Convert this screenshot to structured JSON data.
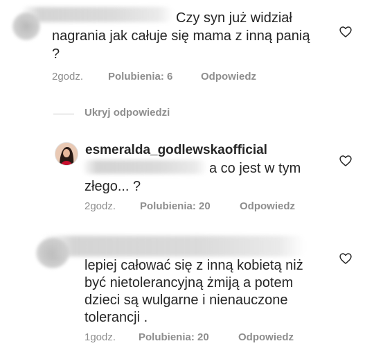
{
  "comments": [
    {
      "text_line1": "Czy syn już widział",
      "text_line2": "nagrania jak całuje się mama z inną panią",
      "text_line3": "?",
      "time": "2godz.",
      "likes": "Polubienia: 6",
      "reply": "Odpowiedz"
    },
    {
      "username": "esmeralda_godlewskaofficial",
      "text_line1": "a co jest w tym",
      "text_line2": "złego... ?",
      "time": "2godz.",
      "likes": "Polubienia: 20",
      "reply": "Odpowiedz"
    },
    {
      "text_line1": "lepiej całować się z inną kobietą niż",
      "text_line2": "być nietolerancyjną żmiją a potem",
      "text_line3": "dzieci są wulgarne i nienauczone",
      "text_line4": "tolerancji .",
      "time": "1godz.",
      "likes": "Polubienia: 20",
      "reply": "Odpowiedz"
    }
  ],
  "hide_replies": "Ukryj odpowiedzi",
  "colors": {
    "text": "#262626",
    "meta": "#8e8e8e",
    "background": "#ffffff"
  },
  "icons": [
    "heart-icon",
    "avatar"
  ]
}
